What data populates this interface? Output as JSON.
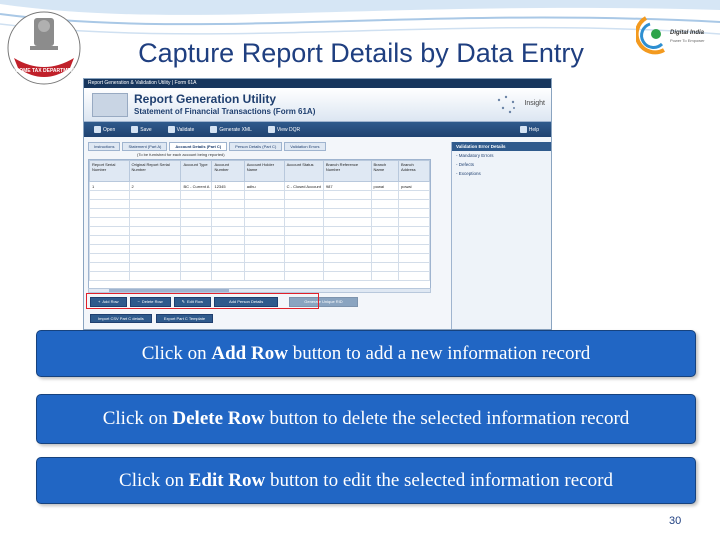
{
  "slide": {
    "title": "Capture Report Details by Data Entry",
    "page_number": "30",
    "left_logo_text": "INCOME TAX DEPARTMENT",
    "right_logo_text": "Digital India",
    "right_logo_subtext": "Power To Empower",
    "colors": {
      "title": "#1f3f80",
      "callout_bg": "#2166c4",
      "highlight": "#e0202a"
    }
  },
  "app": {
    "window_title": "Report Generation & Validation Utility | Form 61A",
    "header_title": "Report Generation Utility",
    "header_subtitle": "Statement of Financial Transactions (Form 61A)",
    "brand": "Insight",
    "toolbar": [
      {
        "label": "Open",
        "icon": "folder-icon"
      },
      {
        "label": "Save",
        "icon": "save-icon"
      },
      {
        "label": "Validate",
        "icon": "check-icon"
      },
      {
        "label": "Generate XML",
        "icon": "xml-icon"
      },
      {
        "label": "View DQR",
        "icon": "report-icon"
      }
    ],
    "help_label": "Help",
    "tabs": [
      "Instructions",
      "Statement (Part A)",
      "Account Details (Part C)",
      "Person Details (Part C)",
      "Validation Errors"
    ],
    "active_tab": 2,
    "note": "(To be furnished for each account being reported)",
    "columns": [
      "Report Serial Number",
      "Original Report Serial Number",
      "Account Type",
      "Account Number",
      "Account Holder Name",
      "Account Status",
      "Branch Reference Number",
      "Branch Name",
      "Branch Address"
    ],
    "rows": [
      [
        "1",
        "2",
        "BC - Current A",
        "12345",
        "adhu",
        "C - Closed Account",
        "987",
        "powai",
        "powai"
      ]
    ],
    "side_panel": {
      "title": "Validation Error Details",
      "items": [
        "Mandatory Errors",
        "Defects",
        "Exceptions"
      ]
    },
    "row_buttons": [
      "Add Row",
      "Delete Row",
      "Edit Row",
      "Add Person Details"
    ],
    "disabled_button": "Generate Unique RID",
    "secondary_buttons": [
      "Import CSV Part C details",
      "Export Part C Template"
    ]
  },
  "callouts": [
    {
      "prefix": "Click on ",
      "bold": "Add Row",
      "suffix": " button to add a new information record"
    },
    {
      "prefix": "Click on ",
      "bold": "Delete Row",
      "suffix": " button to delete the selected information record"
    },
    {
      "prefix": "Click on ",
      "bold": "Edit Row",
      "suffix": " button to edit the selected information record"
    }
  ]
}
